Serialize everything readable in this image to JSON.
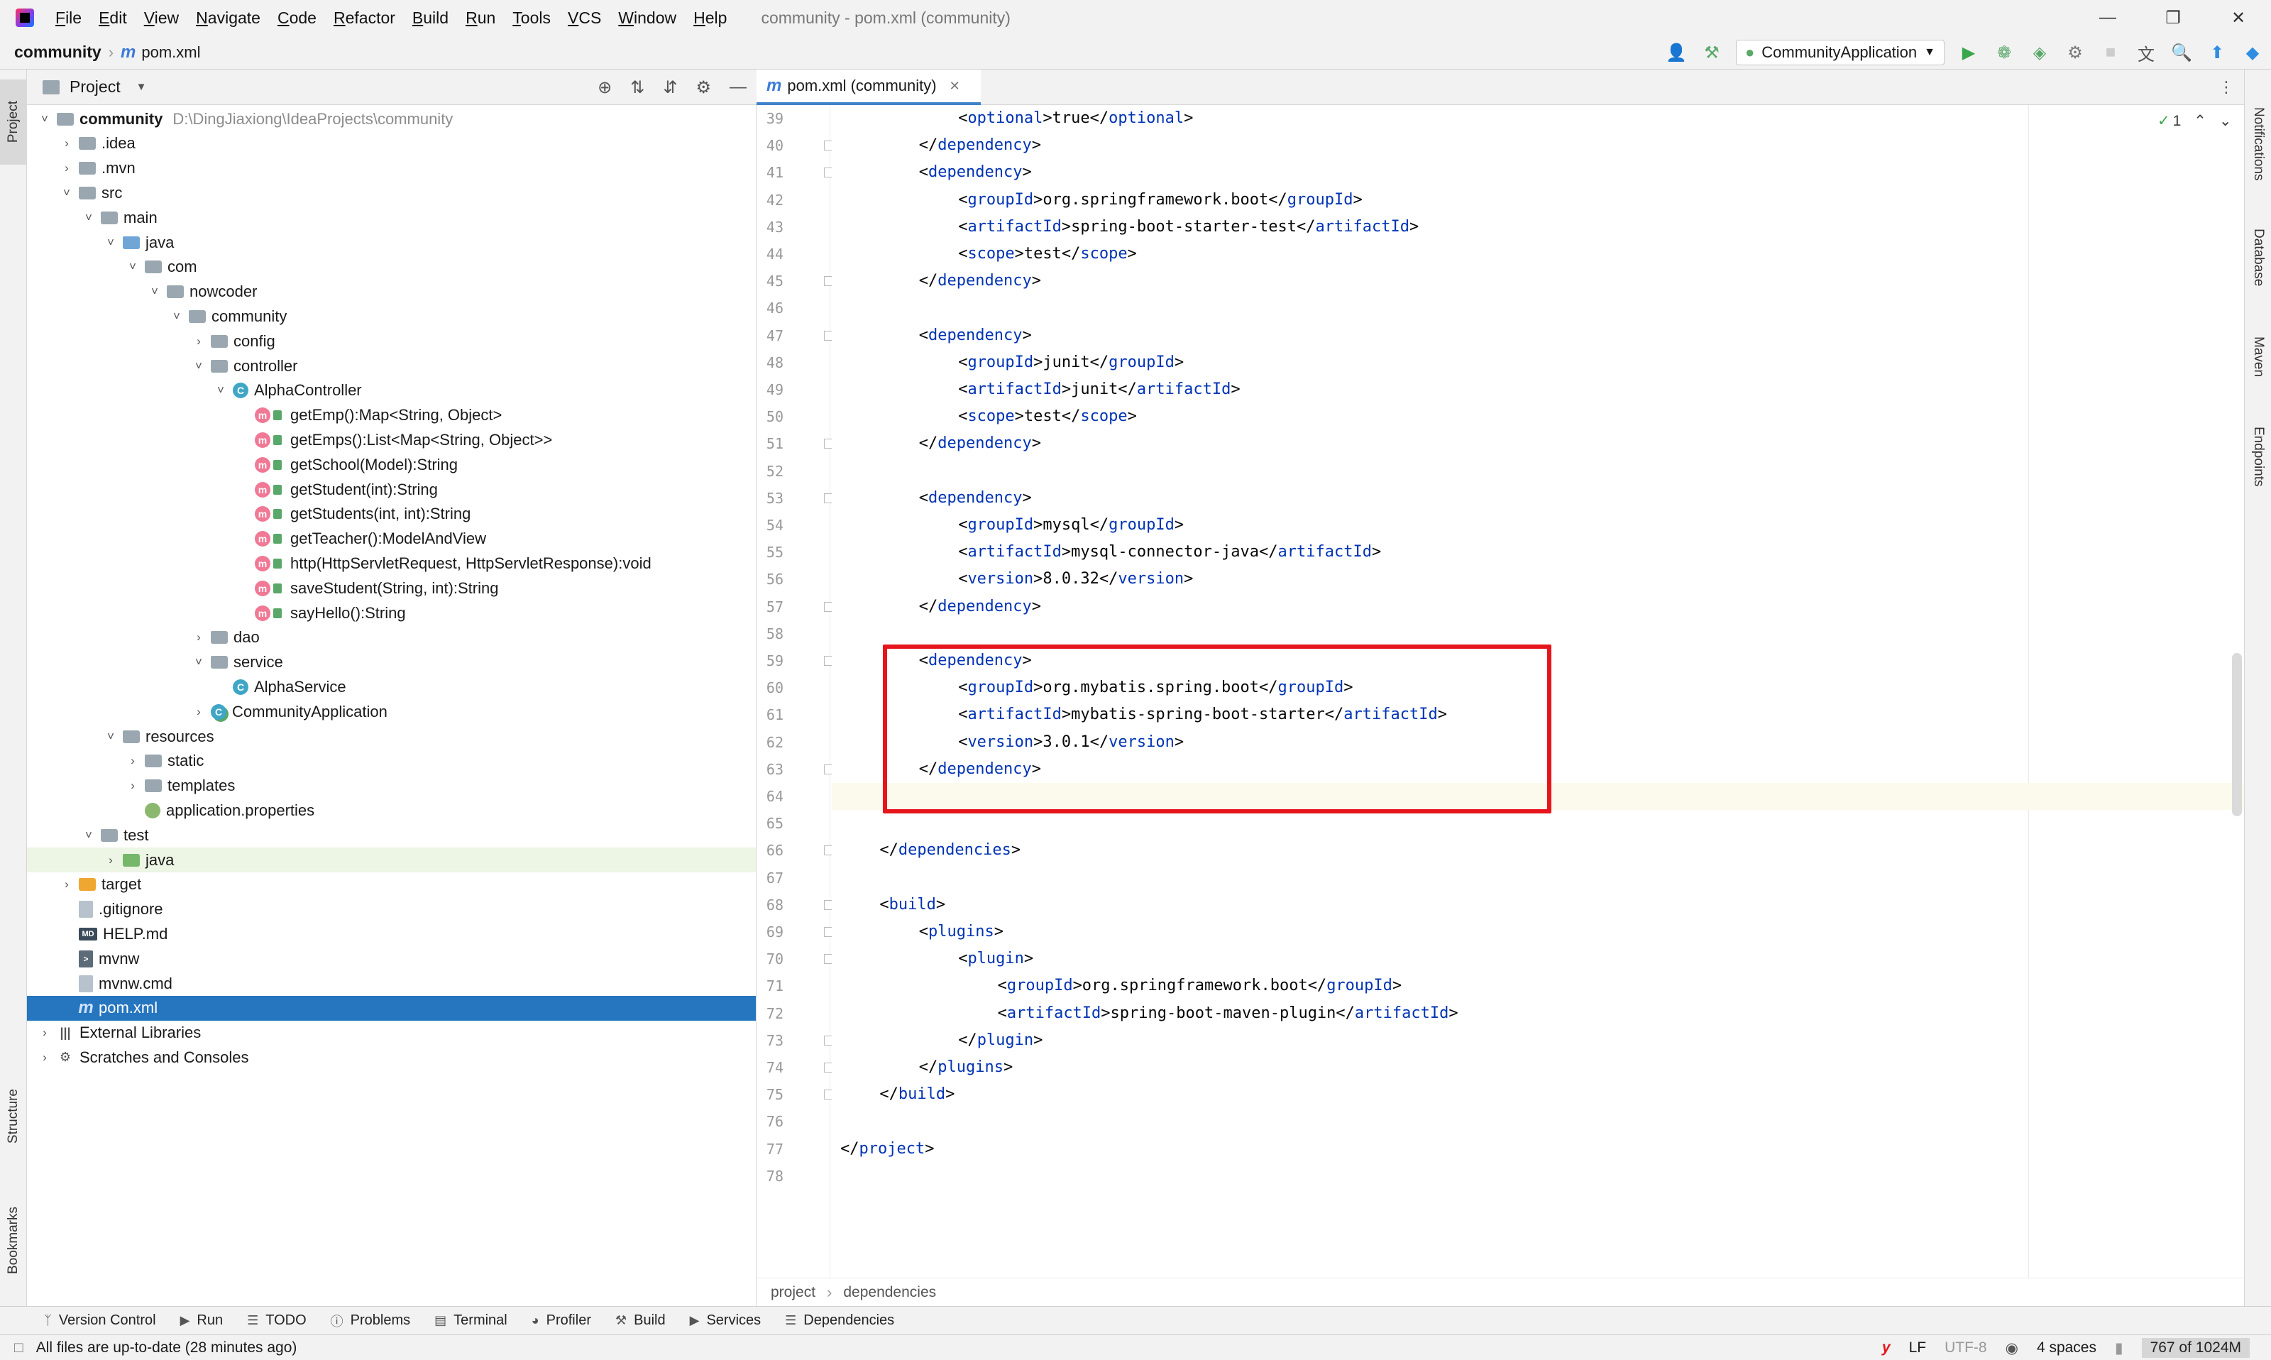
{
  "app": {
    "window_title": "community - pom.xml (community)"
  },
  "menu": [
    "File",
    "Edit",
    "View",
    "Navigate",
    "Code",
    "Refactor",
    "Build",
    "Run",
    "Tools",
    "VCS",
    "Window",
    "Help"
  ],
  "navbar": {
    "project": "community",
    "file": "pom.xml",
    "run_config": "CommunityApplication"
  },
  "project_panel": {
    "title": "Project",
    "tree": [
      {
        "label": "community",
        "extra": "D:\\DingJiaxiong\\IdeaProjects\\community",
        "icon": "folder",
        "depth": 0,
        "chev": "v",
        "bold": true
      },
      {
        "label": ".idea",
        "icon": "folder",
        "depth": 1,
        "chev": ">"
      },
      {
        "label": ".mvn",
        "icon": "folder",
        "depth": 1,
        "chev": ">"
      },
      {
        "label": "src",
        "icon": "folder",
        "depth": 1,
        "chev": "v"
      },
      {
        "label": "main",
        "icon": "folder",
        "depth": 2,
        "chev": "v"
      },
      {
        "label": "java",
        "icon": "folder-blue",
        "depth": 3,
        "chev": "v"
      },
      {
        "label": "com",
        "icon": "folder",
        "depth": 4,
        "chev": "v"
      },
      {
        "label": "nowcoder",
        "icon": "folder",
        "depth": 5,
        "chev": "v"
      },
      {
        "label": "community",
        "icon": "folder",
        "depth": 6,
        "chev": "v"
      },
      {
        "label": "config",
        "icon": "folder",
        "depth": 7,
        "chev": ">"
      },
      {
        "label": "controller",
        "icon": "folder",
        "depth": 7,
        "chev": "v"
      },
      {
        "label": "AlphaController",
        "icon": "class",
        "depth": 8,
        "chev": "v"
      },
      {
        "label": "getEmp():Map<String, Object>",
        "icon": "method",
        "depth": 9
      },
      {
        "label": "getEmps():List<Map<String, Object>>",
        "icon": "method",
        "depth": 9
      },
      {
        "label": "getSchool(Model):String",
        "icon": "method",
        "depth": 9
      },
      {
        "label": "getStudent(int):String",
        "icon": "method",
        "depth": 9
      },
      {
        "label": "getStudents(int, int):String",
        "icon": "method",
        "depth": 9
      },
      {
        "label": "getTeacher():ModelAndView",
        "icon": "method",
        "depth": 9
      },
      {
        "label": "http(HttpServletRequest, HttpServletResponse):void",
        "icon": "method",
        "depth": 9
      },
      {
        "label": "saveStudent(String, int):String",
        "icon": "method",
        "depth": 9
      },
      {
        "label": "sayHello():String",
        "icon": "method",
        "depth": 9
      },
      {
        "label": "dao",
        "icon": "folder",
        "depth": 7,
        "chev": ">"
      },
      {
        "label": "service",
        "icon": "folder",
        "depth": 7,
        "chev": "v"
      },
      {
        "label": "AlphaService",
        "icon": "class",
        "depth": 8
      },
      {
        "label": "CommunityApplication",
        "icon": "class-spring",
        "depth": 7,
        "chev": ">"
      },
      {
        "label": "resources",
        "icon": "folder-res",
        "depth": 3,
        "chev": "v"
      },
      {
        "label": "static",
        "icon": "folder",
        "depth": 4,
        "chev": ">"
      },
      {
        "label": "templates",
        "icon": "folder",
        "depth": 4,
        "chev": ">"
      },
      {
        "label": "application.properties",
        "icon": "props",
        "depth": 4
      },
      {
        "label": "test",
        "icon": "folder",
        "depth": 2,
        "chev": "v"
      },
      {
        "label": "java",
        "icon": "folder-green",
        "depth": 3,
        "chev": ">",
        "highlight": true
      },
      {
        "label": "target",
        "icon": "folder-orange",
        "depth": 1,
        "chev": ">"
      },
      {
        "label": ".gitignore",
        "icon": "file",
        "depth": 1
      },
      {
        "label": "HELP.md",
        "icon": "md",
        "depth": 1
      },
      {
        "label": "mvnw",
        "icon": "mvnw",
        "depth": 1
      },
      {
        "label": "mvnw.cmd",
        "icon": "file",
        "depth": 1
      },
      {
        "label": "pom.xml",
        "icon": "pom",
        "depth": 1,
        "selected": true
      },
      {
        "label": "External Libraries",
        "icon": "lib",
        "depth": 0,
        "chev": ">"
      },
      {
        "label": "Scratches and Consoles",
        "icon": "scratch",
        "depth": 0,
        "chev": ">"
      }
    ]
  },
  "editor": {
    "tab": "pom.xml (community)",
    "inspection": "1",
    "breadcrumb": [
      "project",
      "dependencies"
    ],
    "lines": [
      {
        "n": "39",
        "ind": 3,
        "parts": [
          [
            "t",
            "<"
          ],
          [
            "g",
            "optional"
          ],
          [
            "t",
            ">true</"
          ],
          [
            "g",
            "optional"
          ],
          [
            "t",
            ">"
          ]
        ]
      },
      {
        "n": "40",
        "ind": 2,
        "parts": [
          [
            "t",
            "</"
          ],
          [
            "g",
            "dependency"
          ],
          [
            "t",
            ">"
          ]
        ]
      },
      {
        "n": "41",
        "ind": 2,
        "parts": [
          [
            "t",
            "<"
          ],
          [
            "g",
            "dependency"
          ],
          [
            "t",
            ">"
          ]
        ]
      },
      {
        "n": "42",
        "ind": 3,
        "parts": [
          [
            "t",
            "<"
          ],
          [
            "g",
            "groupId"
          ],
          [
            "t",
            ">org.springframework.boot</"
          ],
          [
            "g",
            "groupId"
          ],
          [
            "t",
            ">"
          ]
        ]
      },
      {
        "n": "43",
        "ind": 3,
        "parts": [
          [
            "t",
            "<"
          ],
          [
            "g",
            "artifactId"
          ],
          [
            "t",
            ">spring-boot-starter-test</"
          ],
          [
            "g",
            "artifactId"
          ],
          [
            "t",
            ">"
          ]
        ]
      },
      {
        "n": "44",
        "ind": 3,
        "parts": [
          [
            "t",
            "<"
          ],
          [
            "g",
            "scope"
          ],
          [
            "t",
            ">test</"
          ],
          [
            "g",
            "scope"
          ],
          [
            "t",
            ">"
          ]
        ]
      },
      {
        "n": "45",
        "ind": 2,
        "parts": [
          [
            "t",
            "</"
          ],
          [
            "g",
            "dependency"
          ],
          [
            "t",
            ">"
          ]
        ]
      },
      {
        "n": "46",
        "ind": 0,
        "parts": []
      },
      {
        "n": "47",
        "ind": 2,
        "parts": [
          [
            "t",
            "<"
          ],
          [
            "g",
            "dependency"
          ],
          [
            "t",
            ">"
          ]
        ]
      },
      {
        "n": "48",
        "ind": 3,
        "parts": [
          [
            "t",
            "<"
          ],
          [
            "g",
            "groupId"
          ],
          [
            "t",
            ">junit</"
          ],
          [
            "g",
            "groupId"
          ],
          [
            "t",
            ">"
          ]
        ]
      },
      {
        "n": "49",
        "ind": 3,
        "parts": [
          [
            "t",
            "<"
          ],
          [
            "g",
            "artifactId"
          ],
          [
            "t",
            ">junit</"
          ],
          [
            "g",
            "artifactId"
          ],
          [
            "t",
            ">"
          ]
        ]
      },
      {
        "n": "50",
        "ind": 3,
        "parts": [
          [
            "t",
            "<"
          ],
          [
            "g",
            "scope"
          ],
          [
            "t",
            ">test</"
          ],
          [
            "g",
            "scope"
          ],
          [
            "t",
            ">"
          ]
        ]
      },
      {
        "n": "51",
        "ind": 2,
        "parts": [
          [
            "t",
            "</"
          ],
          [
            "g",
            "dependency"
          ],
          [
            "t",
            ">"
          ]
        ]
      },
      {
        "n": "52",
        "ind": 0,
        "parts": []
      },
      {
        "n": "53",
        "ind": 2,
        "parts": [
          [
            "t",
            "<"
          ],
          [
            "g",
            "dependency"
          ],
          [
            "t",
            ">"
          ]
        ]
      },
      {
        "n": "54",
        "ind": 3,
        "parts": [
          [
            "t",
            "<"
          ],
          [
            "g",
            "groupId"
          ],
          [
            "t",
            ">mysql</"
          ],
          [
            "g",
            "groupId"
          ],
          [
            "t",
            ">"
          ]
        ]
      },
      {
        "n": "55",
        "ind": 3,
        "parts": [
          [
            "t",
            "<"
          ],
          [
            "g",
            "artifactId"
          ],
          [
            "t",
            ">mysql-connector-java</"
          ],
          [
            "g",
            "artifactId"
          ],
          [
            "t",
            ">"
          ]
        ]
      },
      {
        "n": "56",
        "ind": 3,
        "parts": [
          [
            "t",
            "<"
          ],
          [
            "g",
            "version"
          ],
          [
            "t",
            ">8.0.32</"
          ],
          [
            "g",
            "version"
          ],
          [
            "t",
            ">"
          ]
        ]
      },
      {
        "n": "57",
        "ind": 2,
        "parts": [
          [
            "t",
            "</"
          ],
          [
            "g",
            "dependency"
          ],
          [
            "t",
            ">"
          ]
        ]
      },
      {
        "n": "58",
        "ind": 0,
        "parts": []
      },
      {
        "n": "59",
        "ind": 2,
        "parts": [
          [
            "t",
            "<"
          ],
          [
            "g",
            "dependency"
          ],
          [
            "t",
            ">"
          ]
        ]
      },
      {
        "n": "60",
        "ind": 3,
        "parts": [
          [
            "t",
            "<"
          ],
          [
            "g",
            "groupId"
          ],
          [
            "t",
            ">org.mybatis.spring.boot</"
          ],
          [
            "g",
            "groupId"
          ],
          [
            "t",
            ">"
          ]
        ]
      },
      {
        "n": "61",
        "ind": 3,
        "parts": [
          [
            "t",
            "<"
          ],
          [
            "g",
            "artifactId"
          ],
          [
            "t",
            ">mybatis-spring-boot-starter</"
          ],
          [
            "g",
            "artifactId"
          ],
          [
            "t",
            ">"
          ]
        ]
      },
      {
        "n": "62",
        "ind": 3,
        "parts": [
          [
            "t",
            "<"
          ],
          [
            "g",
            "version"
          ],
          [
            "t",
            ">3.0.1</"
          ],
          [
            "g",
            "version"
          ],
          [
            "t",
            ">"
          ]
        ]
      },
      {
        "n": "63",
        "ind": 2,
        "parts": [
          [
            "t",
            "</"
          ],
          [
            "g",
            "dependency"
          ],
          [
            "t",
            ">"
          ]
        ]
      },
      {
        "n": "64",
        "ind": 0,
        "parts": [],
        "current": true
      },
      {
        "n": "65",
        "ind": 0,
        "parts": []
      },
      {
        "n": "66",
        "ind": 1,
        "parts": [
          [
            "t",
            "</"
          ],
          [
            "g",
            "dependencies"
          ],
          [
            "t",
            ">"
          ]
        ]
      },
      {
        "n": "67",
        "ind": 0,
        "parts": []
      },
      {
        "n": "68",
        "ind": 1,
        "parts": [
          [
            "t",
            "<"
          ],
          [
            "g",
            "build"
          ],
          [
            "t",
            ">"
          ]
        ]
      },
      {
        "n": "69",
        "ind": 2,
        "parts": [
          [
            "t",
            "<"
          ],
          [
            "g",
            "plugins"
          ],
          [
            "t",
            ">"
          ]
        ]
      },
      {
        "n": "70",
        "ind": 3,
        "parts": [
          [
            "t",
            "<"
          ],
          [
            "g",
            "plugin"
          ],
          [
            "t",
            ">"
          ]
        ]
      },
      {
        "n": "71",
        "ind": 4,
        "parts": [
          [
            "t",
            "<"
          ],
          [
            "g",
            "groupId"
          ],
          [
            "t",
            ">org.springframework.boot</"
          ],
          [
            "g",
            "groupId"
          ],
          [
            "t",
            ">"
          ]
        ]
      },
      {
        "n": "72",
        "ind": 4,
        "parts": [
          [
            "t",
            "<"
          ],
          [
            "g",
            "artifactId"
          ],
          [
            "t",
            ">spring-boot-maven-plugin</"
          ],
          [
            "g",
            "artifactId"
          ],
          [
            "t",
            ">"
          ]
        ]
      },
      {
        "n": "73",
        "ind": 3,
        "parts": [
          [
            "t",
            "</"
          ],
          [
            "g",
            "plugin"
          ],
          [
            "t",
            ">"
          ]
        ]
      },
      {
        "n": "74",
        "ind": 2,
        "parts": [
          [
            "t",
            "</"
          ],
          [
            "g",
            "plugins"
          ],
          [
            "t",
            ">"
          ]
        ]
      },
      {
        "n": "75",
        "ind": 1,
        "parts": [
          [
            "t",
            "</"
          ],
          [
            "g",
            "build"
          ],
          [
            "t",
            ">"
          ]
        ]
      },
      {
        "n": "76",
        "ind": 0,
        "parts": []
      },
      {
        "n": "77",
        "ind": 0,
        "parts": [
          [
            "t",
            "</"
          ],
          [
            "g",
            "project"
          ],
          [
            "t",
            ">"
          ]
        ]
      },
      {
        "n": "78",
        "ind": 0,
        "parts": []
      }
    ]
  },
  "side_tabs": {
    "left": [
      "Project",
      "Structure",
      "Bookmarks"
    ],
    "right": [
      "Notifications",
      "Database",
      "Maven",
      "Endpoints"
    ]
  },
  "bottom_tools": [
    "Version Control",
    "Run",
    "TODO",
    "Problems",
    "Terminal",
    "Profiler",
    "Build",
    "Services",
    "Dependencies"
  ],
  "status": {
    "message": "All files are up-to-date (28 minutes ago)",
    "line_sep": "LF",
    "encoding": "UTF-8",
    "indent": "4 spaces",
    "memory": "767 of 1024M"
  }
}
